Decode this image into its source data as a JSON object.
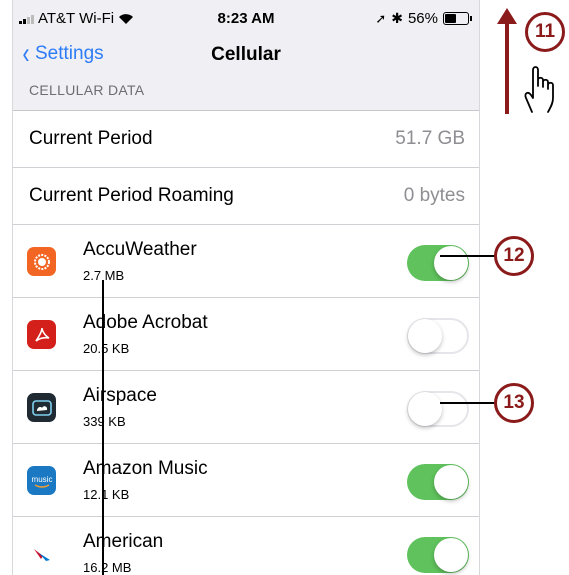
{
  "status_bar": {
    "carrier": "AT&T Wi-Fi",
    "time": "8:23 AM",
    "battery": "56%",
    "battery_level": 0.56
  },
  "nav": {
    "back_label": "Settings",
    "title": "Cellular"
  },
  "section_header": "CELLULAR DATA",
  "usage_rows": [
    {
      "label": "Current Period",
      "value": "51.7 GB"
    },
    {
      "label": "Current Period Roaming",
      "value": "0 bytes"
    }
  ],
  "apps": [
    {
      "name": "AccuWeather",
      "size": "2.7 MB",
      "enabled": true,
      "icon": "accuweather-icon",
      "color": "#f26522"
    },
    {
      "name": "Adobe Acrobat",
      "size": "20.5 KB",
      "enabled": false,
      "icon": "adobe-acrobat-icon",
      "color": "#d4201b"
    },
    {
      "name": "Airspace",
      "size": "339 KB",
      "enabled": false,
      "icon": "airspace-icon",
      "color": "#1f2a33"
    },
    {
      "name": "Amazon Music",
      "size": "12.1 KB",
      "enabled": true,
      "icon": "amazon-music-icon",
      "color": "#1b78c2"
    },
    {
      "name": "American",
      "size": "16.2 MB",
      "enabled": true,
      "icon": "american-airlines-icon",
      "color": "#ffffff"
    }
  ],
  "callouts": [
    "11",
    "12",
    "13"
  ],
  "colors": {
    "ios_blue": "#2d7cf6",
    "toggle_on": "#5fc25c",
    "callout": "#8b1a1a"
  }
}
